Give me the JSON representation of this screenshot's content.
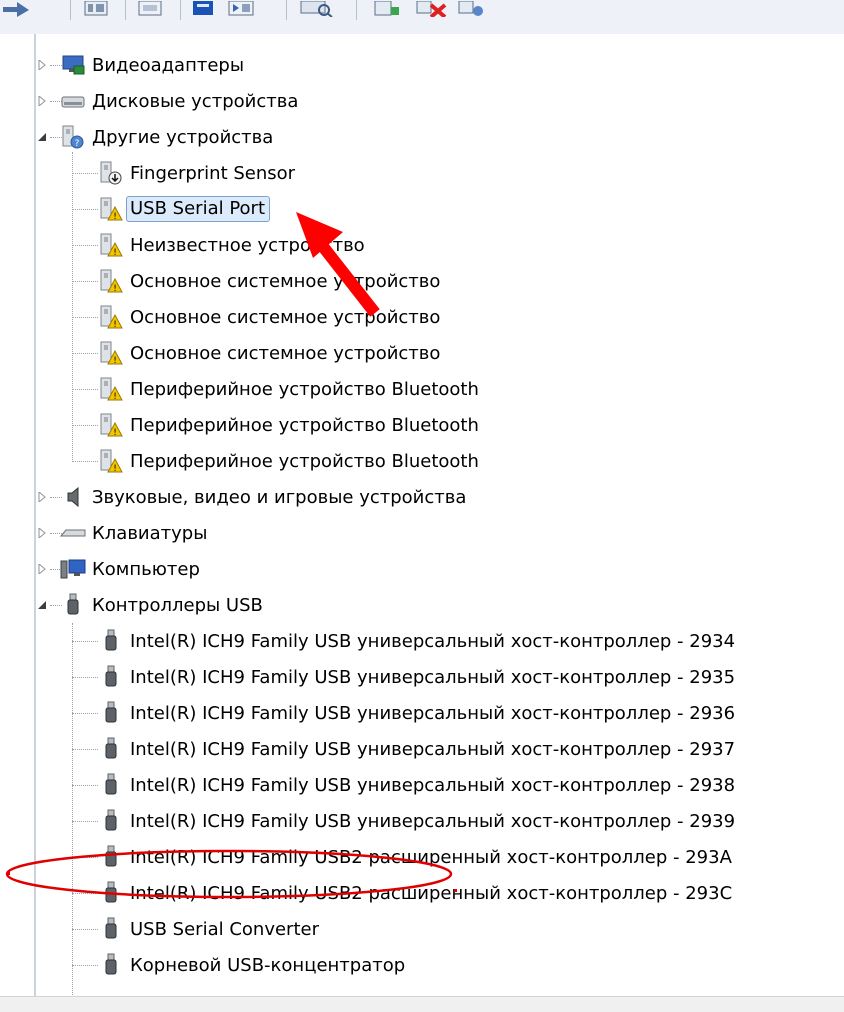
{
  "toolbar": {
    "buttons": [
      {
        "icon": "back-icon"
      },
      {
        "icon": "properties-icon"
      },
      {
        "icon": "help-icon"
      },
      {
        "icon": "show-hidden-icon"
      },
      {
        "icon": "driver-icon"
      },
      {
        "icon": "scan-hardware-icon"
      },
      {
        "icon": "update-driver-icon"
      },
      {
        "icon": "uninstall-icon"
      },
      {
        "icon": "enable-icon"
      }
    ]
  },
  "tree": {
    "categories": [
      {
        "label": "Видеоадаптеры",
        "icon": "display-adapter-icon",
        "expanded": false
      },
      {
        "label": "Дисковые устройства",
        "icon": "disk-drive-icon",
        "expanded": false
      },
      {
        "label": "Другие устройства",
        "icon": "unknown-device-icon",
        "expanded": true,
        "children": [
          {
            "label": "Fingerprint Sensor",
            "icon": "device-download-icon",
            "warning": false
          },
          {
            "label": "USB Serial Port",
            "icon": "device-warning-icon",
            "warning": true,
            "selected": true
          },
          {
            "label": "Неизвестное устройство",
            "icon": "device-warning-icon",
            "warning": true
          },
          {
            "label": "Основное системное устройство",
            "icon": "device-warning-icon",
            "warning": true
          },
          {
            "label": "Основное системное устройство",
            "icon": "device-warning-icon",
            "warning": true
          },
          {
            "label": "Основное системное устройство",
            "icon": "device-warning-icon",
            "warning": true
          },
          {
            "label": "Периферийное устройство Bluetooth",
            "icon": "device-warning-icon",
            "warning": true
          },
          {
            "label": "Периферийное устройство Bluetooth",
            "icon": "device-warning-icon",
            "warning": true
          },
          {
            "label": "Периферийное устройство Bluetooth",
            "icon": "device-warning-icon",
            "warning": true
          }
        ]
      },
      {
        "label": "Звуковые, видео и игровые устройства",
        "icon": "speaker-icon",
        "expanded": false
      },
      {
        "label": "Клавиатуры",
        "icon": "keyboard-icon",
        "expanded": false
      },
      {
        "label": "Компьютер",
        "icon": "computer-icon",
        "expanded": false
      },
      {
        "label": "Контроллеры USB",
        "icon": "usb-plug-icon",
        "expanded": true,
        "children": [
          {
            "label": "Intel(R) ICH9 Family USB универсальный хост-контроллер  - 2934",
            "icon": "usb-plug-icon"
          },
          {
            "label": "Intel(R) ICH9 Family USB универсальный хост-контроллер  - 2935",
            "icon": "usb-plug-icon"
          },
          {
            "label": "Intel(R) ICH9 Family USB универсальный хост-контроллер  - 2936",
            "icon": "usb-plug-icon"
          },
          {
            "label": "Intel(R) ICH9 Family USB универсальный хост-контроллер  - 2937",
            "icon": "usb-plug-icon"
          },
          {
            "label": "Intel(R) ICH9 Family USB универсальный хост-контроллер  - 2938",
            "icon": "usb-plug-icon"
          },
          {
            "label": "Intel(R) ICH9 Family USB универсальный хост-контроллер  - 2939",
            "icon": "usb-plug-icon"
          },
          {
            "label": "Intel(R) ICH9 Family USB2 расширенный хост-контроллер  - 293A",
            "icon": "usb-plug-icon"
          },
          {
            "label": "Intel(R) ICH9 Family USB2 расширенный хост-контроллер  - 293C",
            "icon": "usb-plug-icon"
          },
          {
            "label": "USB Serial Converter",
            "icon": "usb-plug-icon",
            "highlighted": true
          },
          {
            "label": "Корневой USB-концентратор",
            "icon": "usb-plug-icon"
          }
        ]
      }
    ]
  },
  "annotations": {
    "arrow": {
      "color": "#ff0000",
      "target": "USB Serial Port"
    },
    "ellipse": {
      "color": "#e00000",
      "target": "USB Serial Converter"
    }
  }
}
